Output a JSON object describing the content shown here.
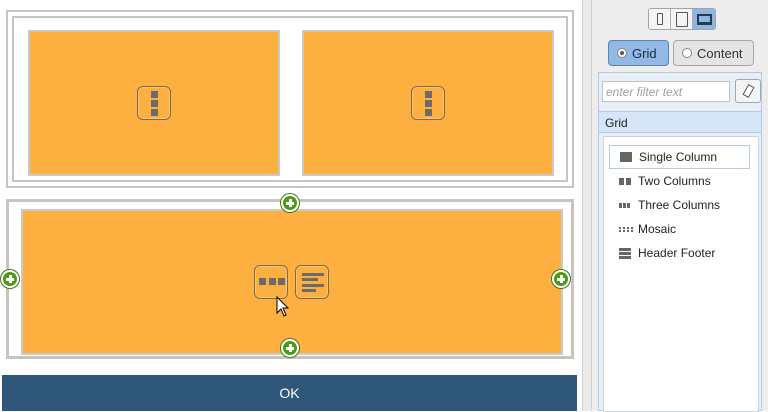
{
  "canvas": {
    "row1": {
      "cells": [
        {
          "name": "cell-1",
          "icon": "vertical-bars-icon"
        },
        {
          "name": "cell-2",
          "icon": "vertical-bars-icon"
        }
      ]
    },
    "row2": {
      "cell_icons": [
        "three-column-layout-icon",
        "text-lines-icon"
      ],
      "add_buttons": [
        "add-top",
        "add-left",
        "add-right",
        "add-bottom"
      ]
    },
    "ok_label": "OK"
  },
  "panel": {
    "devices": [
      "phone-icon",
      "tablet-icon",
      "desktop-icon"
    ],
    "active_device": "desktop-icon",
    "modes": {
      "grid": "Grid",
      "content": "Content",
      "active": "grid"
    },
    "filter": {
      "placeholder": "enter filter text",
      "value": ""
    },
    "section_title": "Grid",
    "layouts": [
      {
        "label": "Single Column",
        "icon": "single-column-icon",
        "selected": true
      },
      {
        "label": "Two Columns",
        "icon": "two-columns-icon"
      },
      {
        "label": "Three Columns",
        "icon": "three-columns-icon"
      },
      {
        "label": "Mosaic",
        "icon": "mosaic-icon"
      },
      {
        "label": "Header Footer",
        "icon": "header-footer-icon"
      }
    ]
  },
  "colors": {
    "cell_fill": "#fdb040",
    "ok_bar": "#2e5779",
    "add_green": "#4c9a16",
    "active_mode": "#93b8e6"
  }
}
